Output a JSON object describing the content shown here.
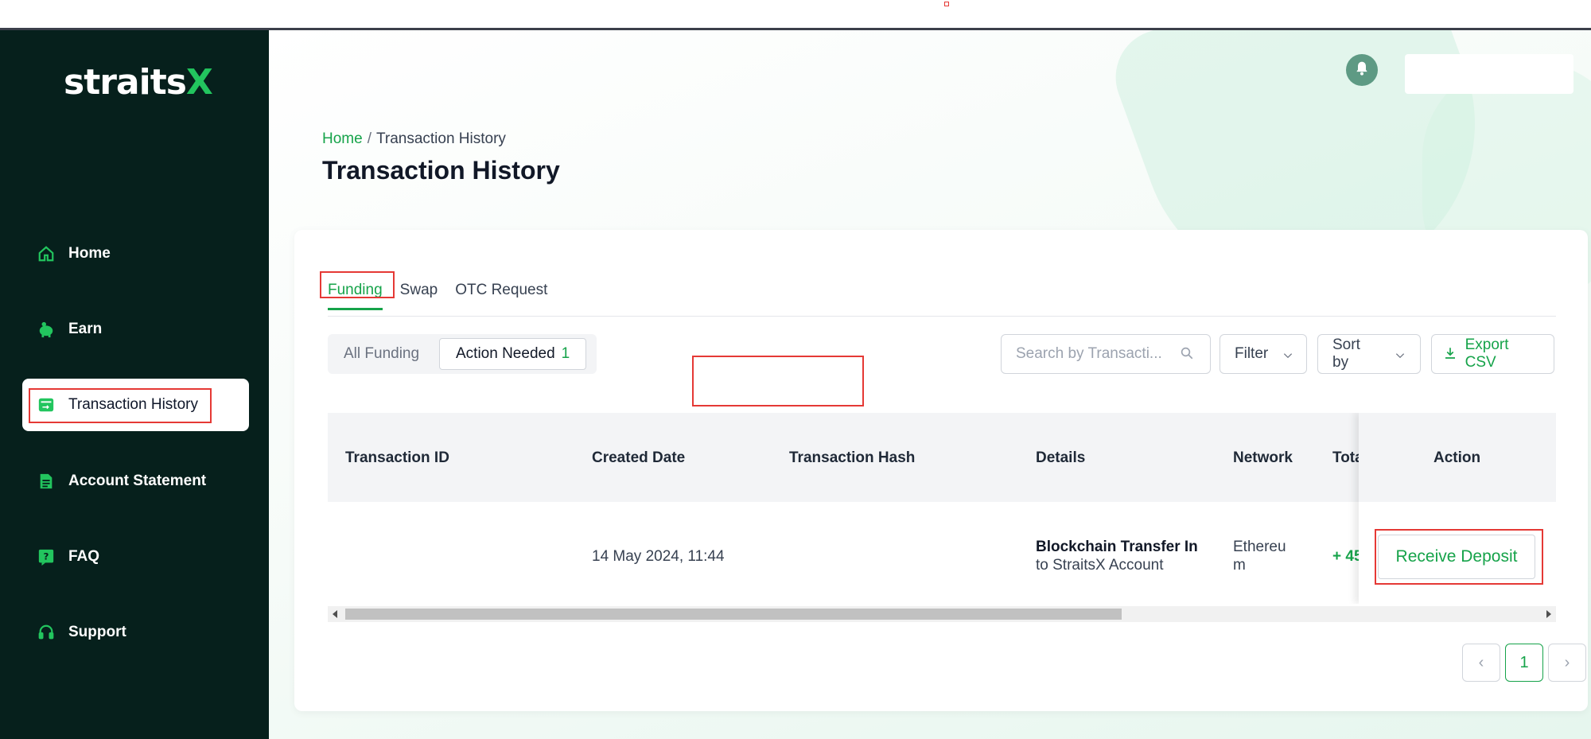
{
  "app": {
    "logo_text": "straits",
    "logo_accent": "X"
  },
  "sidebar": {
    "items": [
      {
        "label": "Home",
        "icon": "home-icon"
      },
      {
        "label": "Earn",
        "icon": "piggy-bank-icon"
      },
      {
        "label": "Transaction History",
        "icon": "wallet-icon",
        "active": true
      },
      {
        "label": "Account Statement",
        "icon": "document-icon"
      },
      {
        "label": "FAQ",
        "icon": "question-icon"
      },
      {
        "label": "Support",
        "icon": "headset-icon"
      }
    ]
  },
  "header": {
    "bell_icon": "bell-icon"
  },
  "breadcrumb": {
    "home": "Home",
    "separator": "/",
    "current": "Transaction History"
  },
  "page": {
    "title": "Transaction History"
  },
  "tabs": [
    {
      "label": "Funding",
      "active": true
    },
    {
      "label": "Swap"
    },
    {
      "label": "OTC Request"
    }
  ],
  "segments": {
    "all": "All Funding",
    "action_needed": "Action Needed",
    "action_needed_count": "1"
  },
  "toolbar": {
    "search_placeholder": "Search by Transacti...",
    "filter_label": "Filter",
    "sort_label": "Sort by",
    "export_label": "Export CSV"
  },
  "table": {
    "columns": [
      "Transaction ID",
      "Created Date",
      "Transaction Hash",
      "Details",
      "Network",
      "Tota",
      "Action"
    ],
    "rows": [
      {
        "transaction_id": "",
        "created_date": "14 May 2024, 11:44",
        "transaction_hash": "",
        "details_title": "Blockchain Transfer In",
        "details_sub": "to StraitsX Account",
        "network_line1": "Ethereu",
        "network_line2": "m",
        "total": "+ 45",
        "action_label": "Receive Deposit"
      }
    ]
  },
  "pagination": {
    "current": "1",
    "prev": "‹",
    "next": "›"
  },
  "colors": {
    "accent": "#16a34a",
    "sidebar_bg": "#06201c",
    "highlight": "#e53935"
  }
}
